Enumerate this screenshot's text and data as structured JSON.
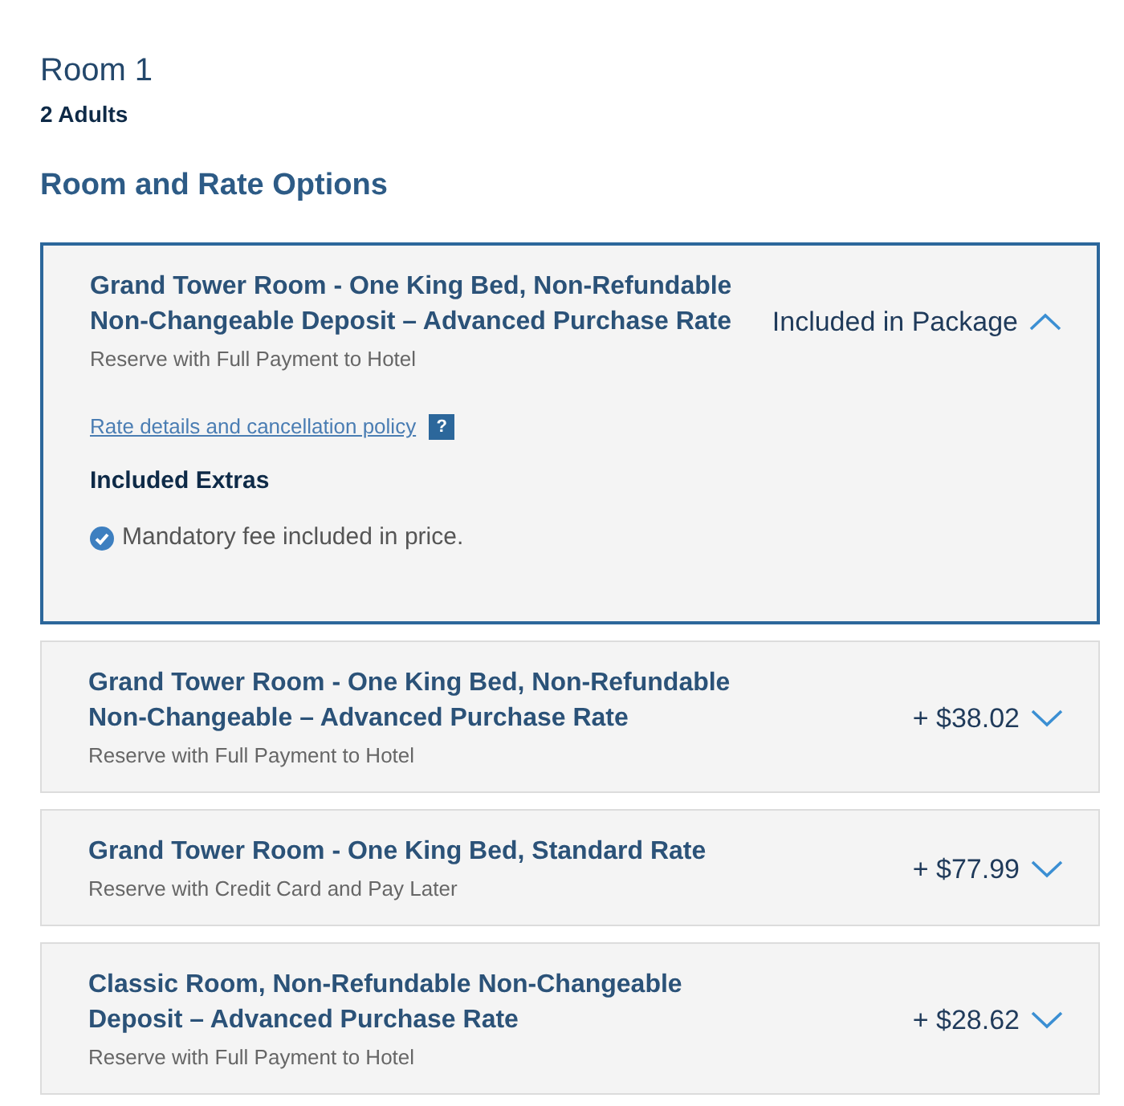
{
  "room": {
    "title": "Room 1",
    "guests": "2 Adults"
  },
  "section_title": "Room and Rate Options",
  "rates": [
    {
      "name": "Grand Tower Room - One King Bed, Non-Refundable Non-Changeable Deposit – Advanced Purchase Rate",
      "payment": "Reserve with Full Payment to Hotel",
      "price": "Included in Package",
      "expanded": true,
      "details": {
        "link": "Rate details and cancellation policy",
        "help": "?",
        "extras_title": "Included Extras",
        "extras": [
          "Mandatory fee included in price."
        ]
      }
    },
    {
      "name": "Grand Tower Room - One King Bed, Non-Refundable Non-Changeable – Advanced Purchase Rate",
      "payment": "Reserve with Full Payment to Hotel",
      "price": "+ $38.02",
      "expanded": false
    },
    {
      "name": "Grand Tower Room - One King Bed, Standard Rate",
      "payment": "Reserve with Credit Card and Pay Later",
      "price": "+ $77.99",
      "expanded": false
    },
    {
      "name": "Classic Room, Non-Refundable Non-Changeable Deposit – Advanced Purchase Rate",
      "payment": "Reserve with Full Payment to Hotel",
      "price": "+ $28.62",
      "expanded": false
    }
  ]
}
